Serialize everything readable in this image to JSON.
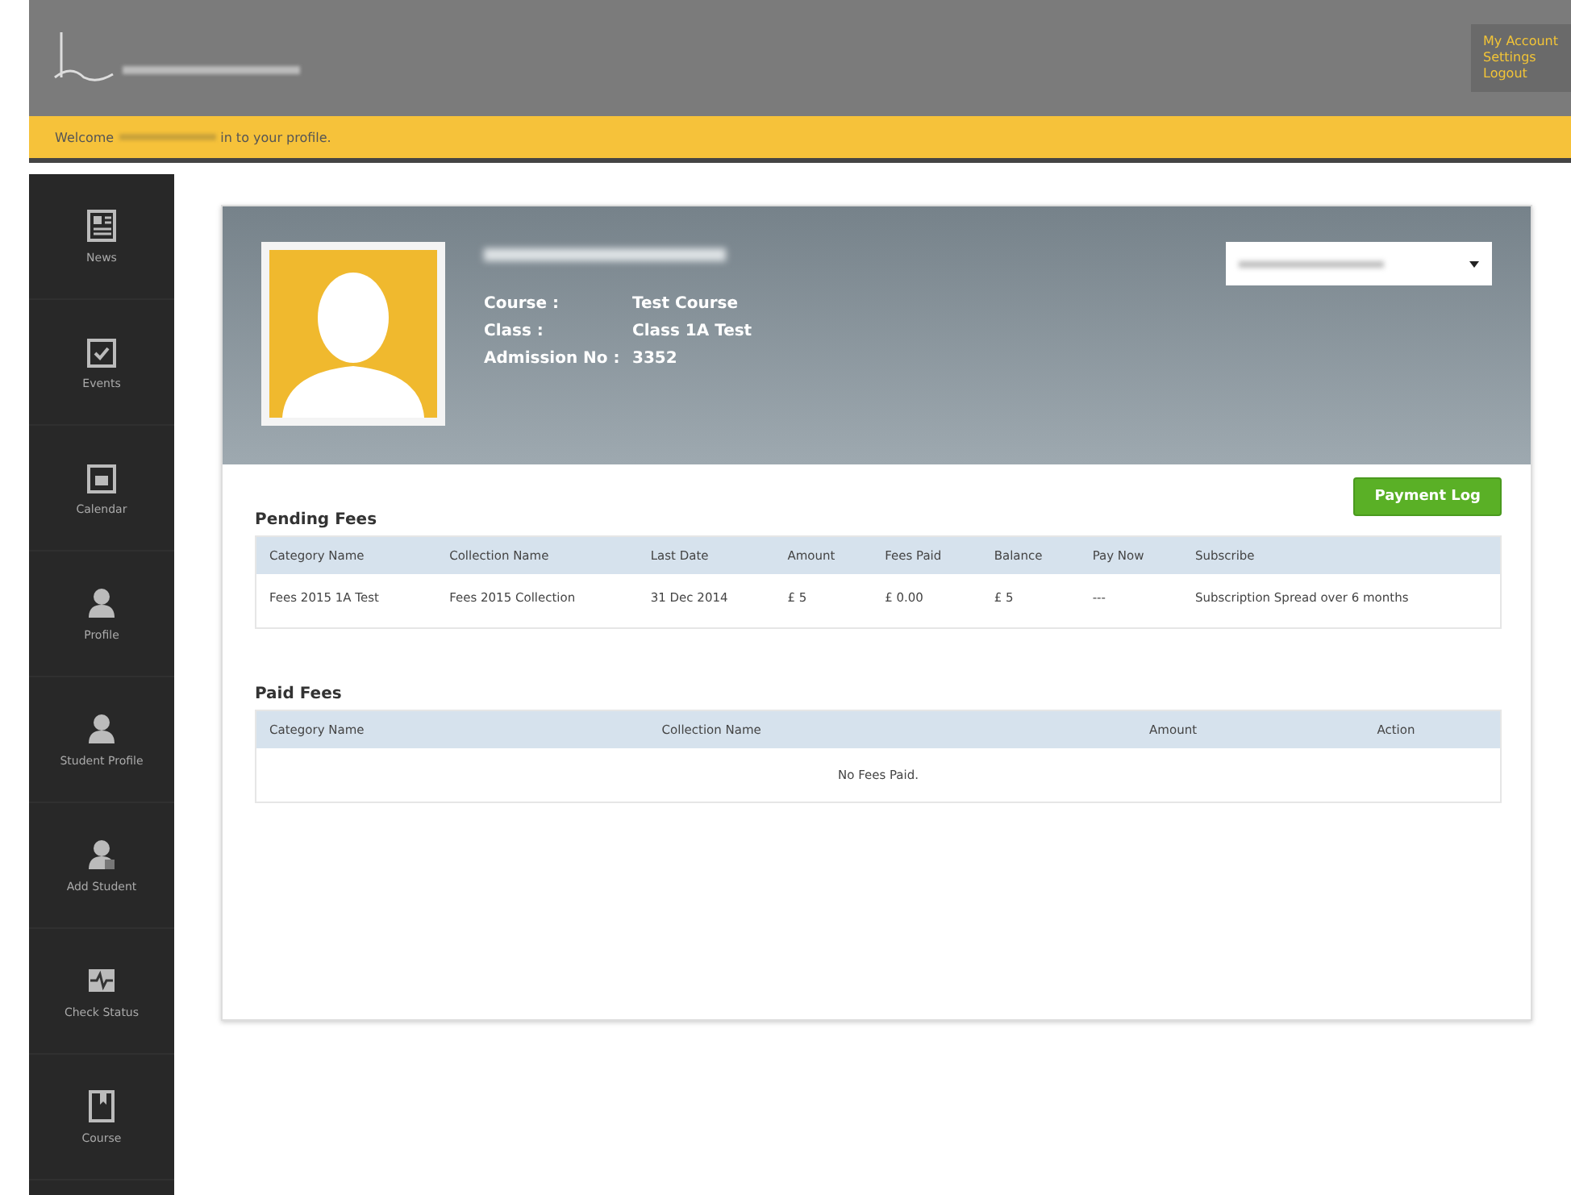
{
  "header": {
    "links": [
      "My Account",
      "Settings",
      "Logout"
    ]
  },
  "welcome": {
    "before": "Welcome",
    "after": "in to your profile."
  },
  "sidebar": {
    "items": [
      {
        "label": "News",
        "kind": "news"
      },
      {
        "label": "Events",
        "kind": "events"
      },
      {
        "label": "Calendar",
        "kind": "calendar"
      },
      {
        "label": "Profile",
        "kind": "person"
      },
      {
        "label": "Student Profile",
        "kind": "student"
      },
      {
        "label": "Add Student",
        "kind": "add"
      },
      {
        "label": "Check Status",
        "kind": "status"
      },
      {
        "label": "Course",
        "kind": "course"
      }
    ]
  },
  "profile": {
    "fields": [
      {
        "label": "Course :",
        "value": "Test Course"
      },
      {
        "label": "Class :",
        "value": "Class 1A Test"
      },
      {
        "label": "Admission No :",
        "value": "3352"
      }
    ]
  },
  "payment_log_button": "Payment Log",
  "pending": {
    "title": "Pending Fees",
    "columns": [
      "Category Name",
      "Collection Name",
      "Last Date",
      "Amount",
      "Fees Paid",
      "Balance",
      "Pay Now",
      "Subscribe"
    ],
    "rows": [
      [
        "Fees 2015 1A Test",
        "Fees 2015 Collection",
        "31 Dec 2014",
        "£ 5",
        "£ 0.00",
        "£ 5",
        "---",
        "Subscription Spread over 6 months"
      ]
    ]
  },
  "paid": {
    "title": "Paid Fees",
    "columns": [
      "Category Name",
      "Collection Name",
      "Amount",
      "Action"
    ],
    "empty": "No Fees Paid."
  }
}
